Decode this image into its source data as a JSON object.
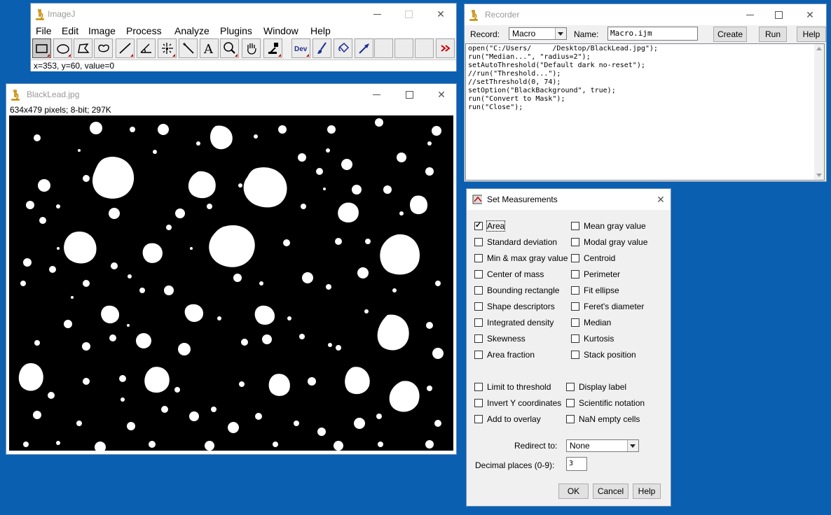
{
  "imagej": {
    "title": "ImageJ",
    "menus": [
      "File",
      "Edit",
      "Image",
      "Process",
      "Analyze",
      "Plugins",
      "Window",
      "Help"
    ],
    "tools": [
      {
        "name": "rectangle-tool",
        "selected": true
      },
      {
        "name": "oval-tool"
      },
      {
        "name": "polygon-tool"
      },
      {
        "name": "freehand-tool"
      },
      {
        "name": "line-tool"
      },
      {
        "name": "angle-tool"
      },
      {
        "name": "point-tool"
      },
      {
        "name": "wand-tool"
      },
      {
        "name": "text-tool"
      },
      {
        "name": "magnifier-tool"
      },
      {
        "name": "hand-tool"
      },
      {
        "name": "color-picker-tool"
      },
      {
        "name": "developer-menu",
        "label": "Dev"
      },
      {
        "name": "brush-tool"
      },
      {
        "name": "flood-fill-tool"
      },
      {
        "name": "arrow-tool"
      },
      {
        "name": "empty-slot"
      },
      {
        "name": "empty-slot"
      },
      {
        "name": "empty-slot"
      },
      {
        "name": "empty-slot"
      },
      {
        "name": "more-tools-menu"
      }
    ],
    "status": "x=353, y=60, value=0"
  },
  "image_window": {
    "title": "BlackLead.jpg",
    "info": "634x479 pixels; 8-bit; 297K"
  },
  "recorder": {
    "title": "Recorder",
    "record_label": "Record:",
    "record_value": "Macro",
    "name_label": "Name:",
    "name_value": "Macro.ijm",
    "create_button": "Create",
    "run_button": "Run",
    "help_button": "Help",
    "code": "open(\"C:/Users/     /Desktop/BlackLead.jpg\");\nrun(\"Median...\", \"radius=2\");\nsetAutoThreshold(\"Default dark no-reset\");\n//run(\"Threshold...\");\n//setThreshold(0, 74);\nsetOption(\"BlackBackground\", true);\nrun(\"Convert to Mask\");\nrun(\"Close\");"
  },
  "set_measurements": {
    "title": "Set Measurements",
    "left_items": [
      {
        "label": "Area",
        "checked": true
      },
      {
        "label": "Standard deviation",
        "checked": false
      },
      {
        "label": "Min & max gray value",
        "checked": false
      },
      {
        "label": "Center of mass",
        "checked": false
      },
      {
        "label": "Bounding rectangle",
        "checked": false
      },
      {
        "label": "Shape descriptors",
        "checked": false
      },
      {
        "label": "Integrated density",
        "checked": false
      },
      {
        "label": "Skewness",
        "checked": false
      },
      {
        "label": "Area fraction",
        "checked": false
      }
    ],
    "right_items": [
      {
        "label": "Mean gray value",
        "checked": false
      },
      {
        "label": "Modal gray value",
        "checked": false
      },
      {
        "label": "Centroid",
        "checked": false
      },
      {
        "label": "Perimeter",
        "checked": false
      },
      {
        "label": "Fit ellipse",
        "checked": false
      },
      {
        "label": "Feret's diameter",
        "checked": false
      },
      {
        "label": "Median",
        "checked": false
      },
      {
        "label": "Kurtosis",
        "checked": false
      },
      {
        "label": "Stack position",
        "checked": false
      }
    ],
    "option_left": [
      {
        "label": "Limit to threshold",
        "checked": false
      },
      {
        "label": "Invert Y coordinates",
        "checked": false
      },
      {
        "label": "Add to overlay",
        "checked": false
      }
    ],
    "option_right": [
      {
        "label": "Display label",
        "checked": false
      },
      {
        "label": "Scientific notation",
        "checked": false
      },
      {
        "label": "NaN empty cells",
        "checked": false
      }
    ],
    "redirect_label": "Redirect to:",
    "redirect_value": "None",
    "decimal_label": "Decimal places (0-9):",
    "decimal_value": "3",
    "ok_button": "OK",
    "cancel_button": "Cancel",
    "help_button": "Help"
  }
}
